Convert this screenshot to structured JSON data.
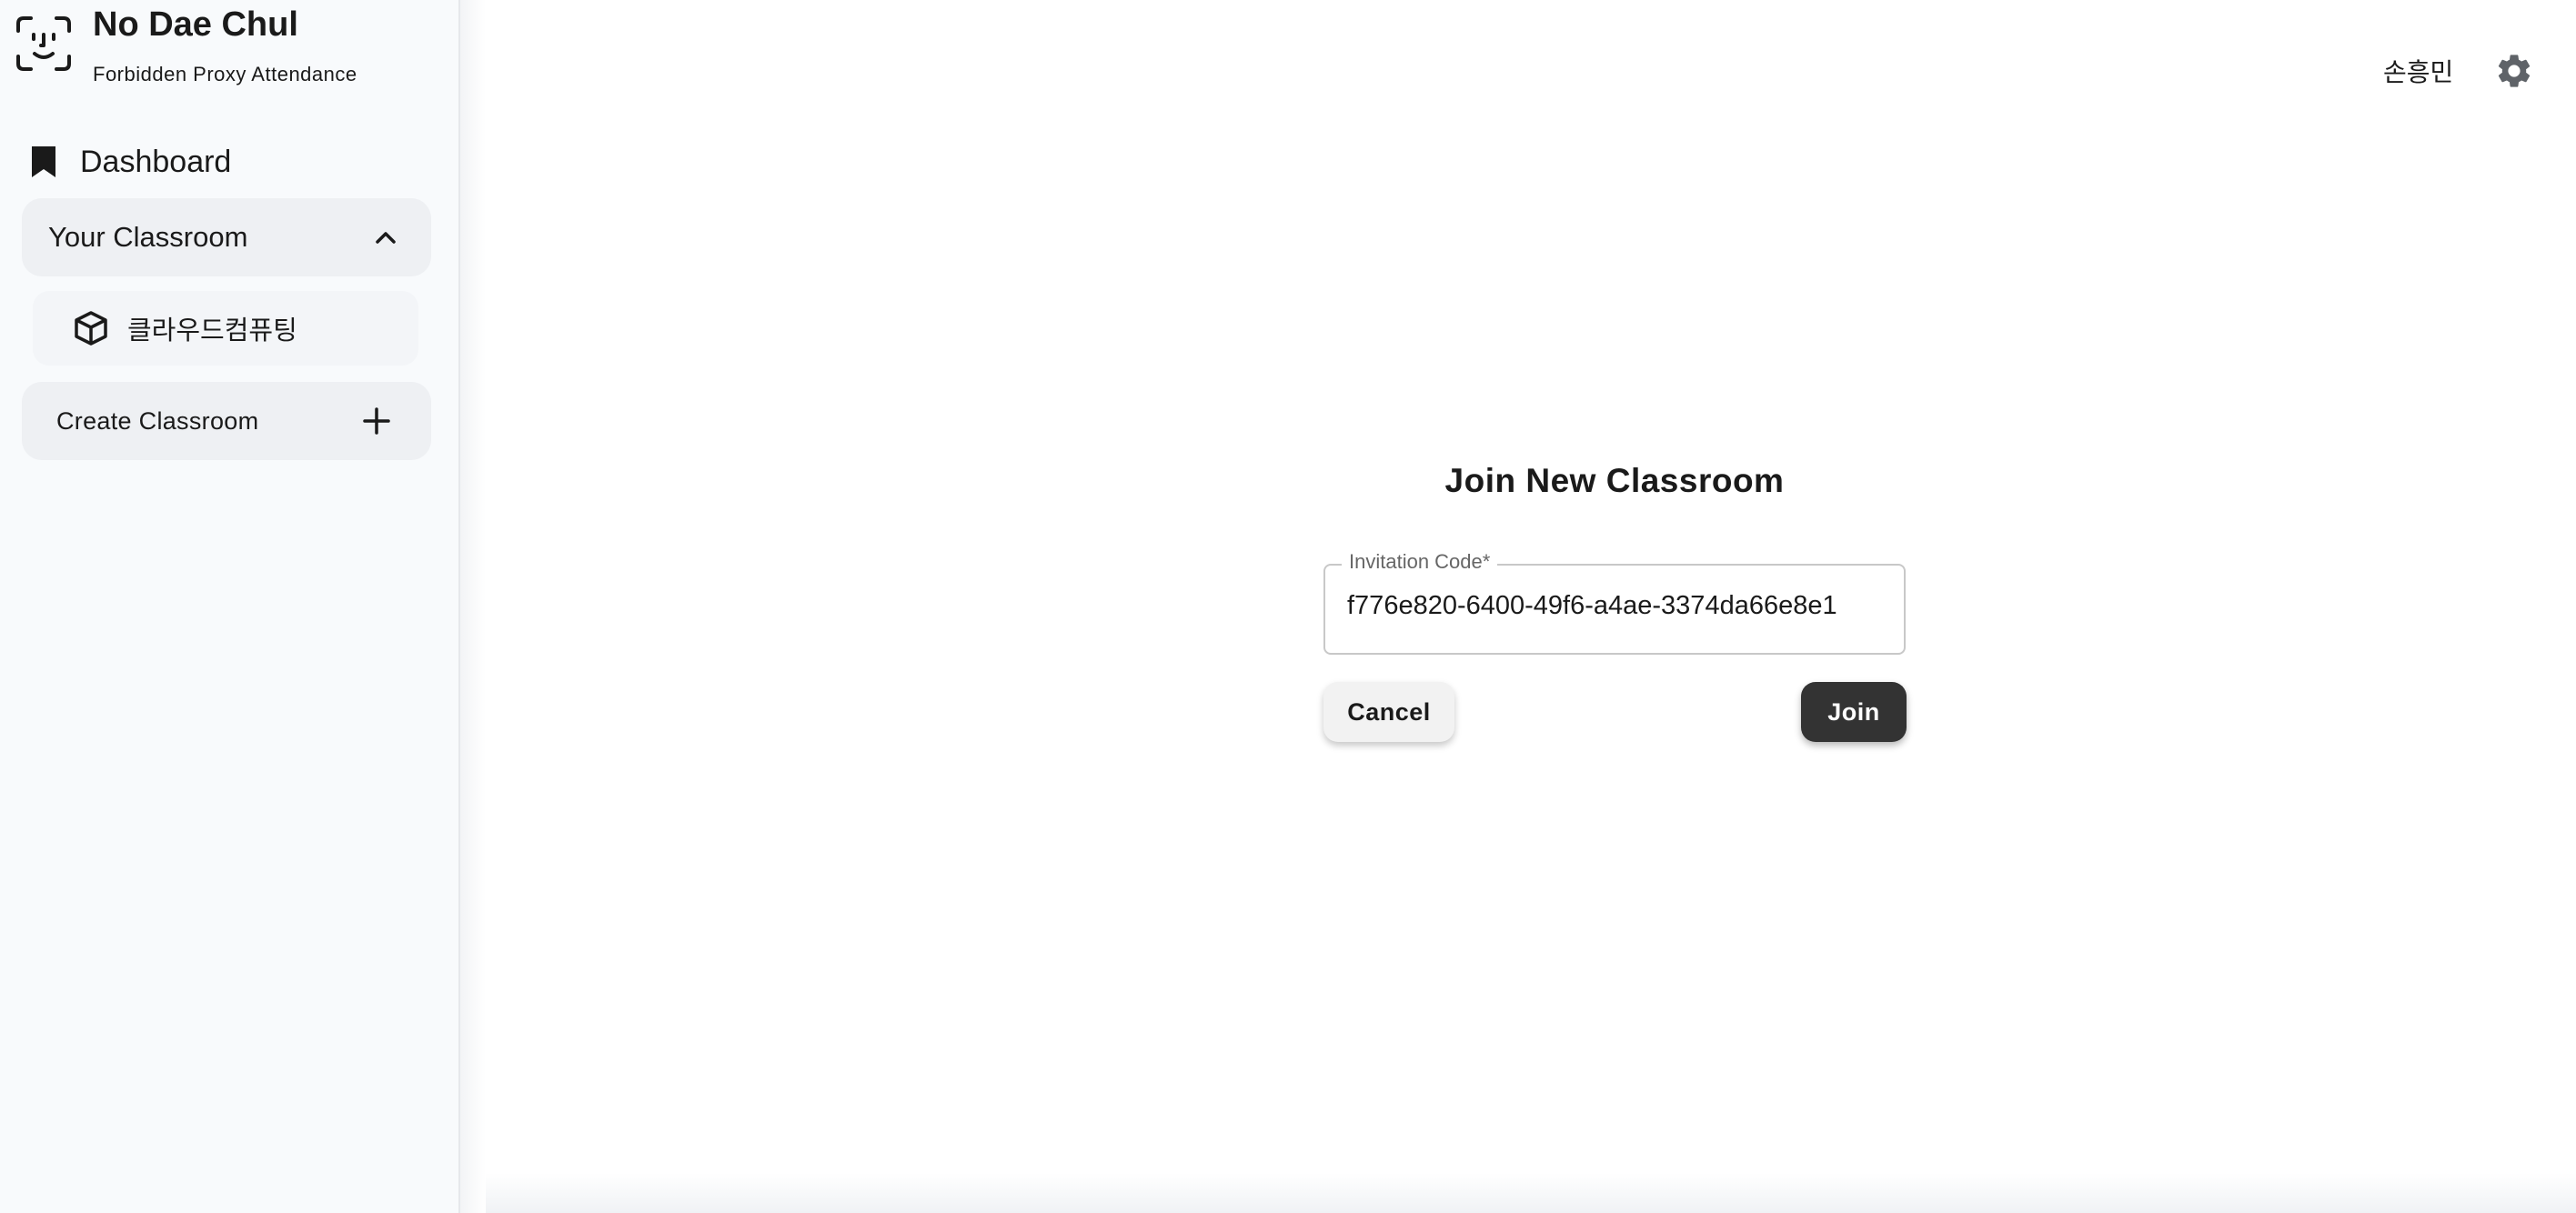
{
  "brand": {
    "title": "No Dae Chul",
    "subtitle": "Forbidden Proxy Attendance",
    "icon": "face-scan-icon"
  },
  "sidebar": {
    "dashboard": {
      "label": "Dashboard",
      "icon": "bookmark-icon"
    },
    "your_classroom": {
      "label": "Your Classroom",
      "expanded": true,
      "icon": "chevron-up-icon"
    },
    "classrooms": [
      {
        "label": "클라우드컴퓨팅",
        "icon": "cube-icon"
      }
    ],
    "create_classroom": {
      "label": "Create Classroom",
      "icon": "plus-icon"
    }
  },
  "header": {
    "user_name": "손흥민",
    "settings_icon": "gear-icon"
  },
  "dialog": {
    "title": "Join New Classroom",
    "field_label": "Invitation Code",
    "required_marker": "*",
    "field_value": "f776e820-6400-49f6-a4ae-3374da66e8e1",
    "cancel_label": "Cancel",
    "join_label": "Join"
  },
  "colors": {
    "sidebar_bg": "#f8fafc",
    "nav_item_bg": "#eef0f3",
    "primary_button": "#333333",
    "secondary_button": "#f2f2f2"
  }
}
